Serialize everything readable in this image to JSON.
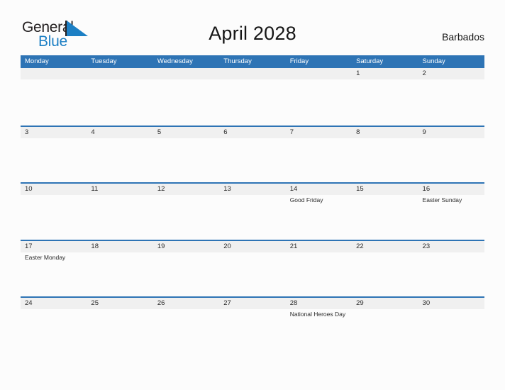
{
  "brand": {
    "name_line1": "General",
    "name_line2": "Blue",
    "triangle_color": "#1c7fc4",
    "text_color": "#231f20"
  },
  "header": {
    "title": "April 2028",
    "locale": "Barbados"
  },
  "colors": {
    "header_blue": "#2e74b5",
    "band_gray": "#f0f0f0",
    "page_background": "#fcfcfc",
    "text": "#2a2a2a"
  },
  "weekdays": [
    "Monday",
    "Tuesday",
    "Wednesday",
    "Thursday",
    "Friday",
    "Saturday",
    "Sunday"
  ],
  "weeks": [
    {
      "days": [
        {
          "num": "",
          "event": ""
        },
        {
          "num": "",
          "event": ""
        },
        {
          "num": "",
          "event": ""
        },
        {
          "num": "",
          "event": ""
        },
        {
          "num": "",
          "event": ""
        },
        {
          "num": "1",
          "event": ""
        },
        {
          "num": "2",
          "event": ""
        }
      ]
    },
    {
      "days": [
        {
          "num": "3",
          "event": ""
        },
        {
          "num": "4",
          "event": ""
        },
        {
          "num": "5",
          "event": ""
        },
        {
          "num": "6",
          "event": ""
        },
        {
          "num": "7",
          "event": ""
        },
        {
          "num": "8",
          "event": ""
        },
        {
          "num": "9",
          "event": ""
        }
      ]
    },
    {
      "days": [
        {
          "num": "10",
          "event": ""
        },
        {
          "num": "11",
          "event": ""
        },
        {
          "num": "12",
          "event": ""
        },
        {
          "num": "13",
          "event": ""
        },
        {
          "num": "14",
          "event": "Good Friday"
        },
        {
          "num": "15",
          "event": ""
        },
        {
          "num": "16",
          "event": "Easter Sunday"
        }
      ]
    },
    {
      "days": [
        {
          "num": "17",
          "event": "Easter Monday"
        },
        {
          "num": "18",
          "event": ""
        },
        {
          "num": "19",
          "event": ""
        },
        {
          "num": "20",
          "event": ""
        },
        {
          "num": "21",
          "event": ""
        },
        {
          "num": "22",
          "event": ""
        },
        {
          "num": "23",
          "event": ""
        }
      ]
    },
    {
      "days": [
        {
          "num": "24",
          "event": ""
        },
        {
          "num": "25",
          "event": ""
        },
        {
          "num": "26",
          "event": ""
        },
        {
          "num": "27",
          "event": ""
        },
        {
          "num": "28",
          "event": "National Heroes Day"
        },
        {
          "num": "29",
          "event": ""
        },
        {
          "num": "30",
          "event": ""
        }
      ]
    }
  ]
}
